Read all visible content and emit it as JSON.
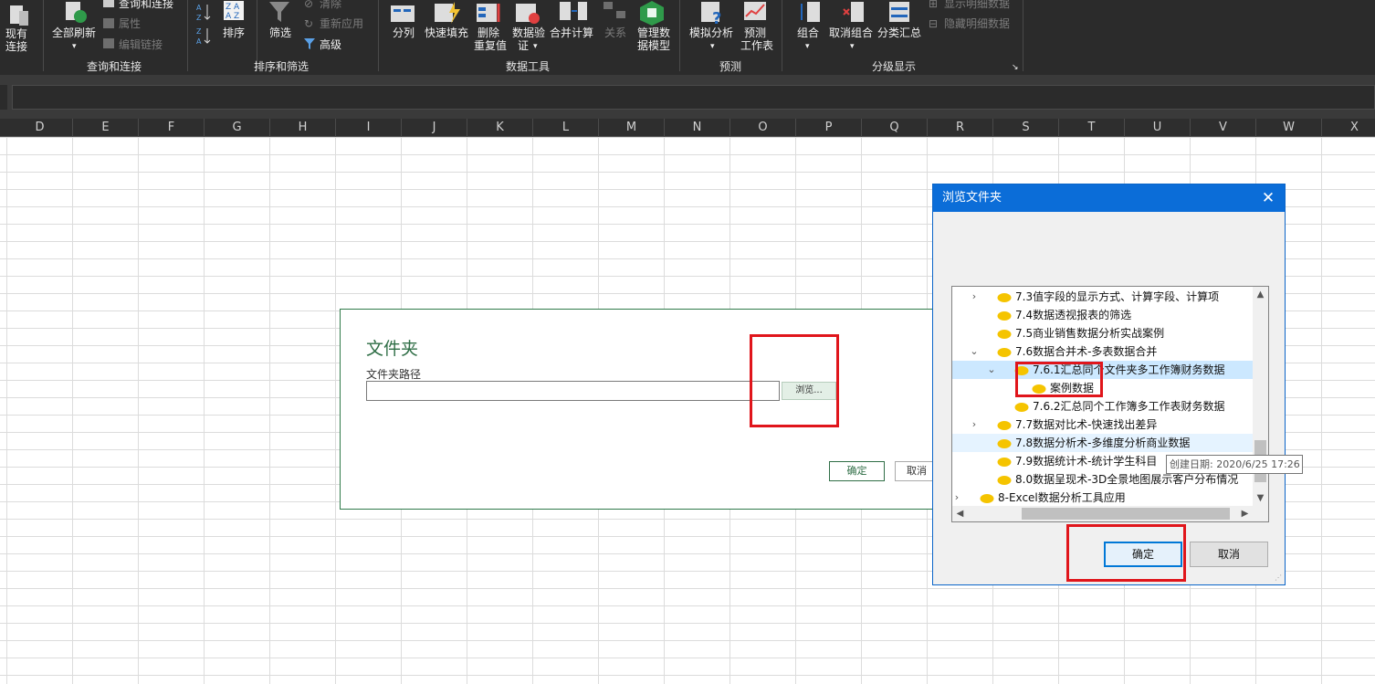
{
  "ribbon": {
    "existing_connections": [
      "现有",
      "连接"
    ],
    "refresh_all": "全部刷新",
    "queries_connections": "查询和连接",
    "properties": "属性",
    "edit_links": "编辑链接",
    "group_queries": "查询和连接",
    "sort": "排序",
    "filter": "筛选",
    "clear": "清除",
    "reapply": "重新应用",
    "advanced": "高级",
    "group_sort_filter": "排序和筛选",
    "text_to_columns": "分列",
    "flash_fill": "快速填充",
    "remove_duplicates": [
      "删除",
      "重复值"
    ],
    "data_validation": [
      "数据验",
      "证"
    ],
    "consolidate": "合并计算",
    "relationships": "关系",
    "manage_data_model": [
      "管理数",
      "据模型"
    ],
    "group_data_tools": "数据工具",
    "what_if": "模拟分析",
    "forecast_sheet": [
      "预测",
      "工作表"
    ],
    "group_forecast": "预测",
    "group_btn": "组合",
    "ungroup": "取消组合",
    "subtotal": "分类汇总",
    "show_detail": "显示明细数据",
    "hide_detail": "隐藏明细数据",
    "group_outline": "分级显示"
  },
  "columns": [
    "D",
    "E",
    "F",
    "G",
    "H",
    "I",
    "J",
    "K",
    "L",
    "M",
    "N",
    "O",
    "P",
    "Q",
    "R",
    "S",
    "T",
    "U",
    "V",
    "W",
    "X"
  ],
  "folder_dialog": {
    "title": "文件夹",
    "path_label": "文件夹路径",
    "path_value": "",
    "browse": "浏览...",
    "ok": "确定",
    "cancel": "取消"
  },
  "browse_dialog": {
    "title": "浏览文件夹",
    "close": "✕",
    "items": [
      {
        "label": "7.3值字段的显示方式、计算字段、计算项",
        "expander": "›",
        "depth": 2
      },
      {
        "label": "7.4数据透视报表的筛选",
        "expander": "",
        "depth": 2
      },
      {
        "label": "7.5商业销售数据分析实战案例",
        "expander": "",
        "depth": 2
      },
      {
        "label": "7.6数据合并术-多表数据合并",
        "expander": "⌄",
        "depth": 2
      },
      {
        "label": "7.6.1汇总同个文件夹多工作簿财务数据",
        "expander": "⌄",
        "depth": 3
      },
      {
        "label": "案例数据",
        "expander": "",
        "depth": 4
      },
      {
        "label": "7.6.2汇总同个工作簿多工作表财务数据",
        "expander": "",
        "depth": 3
      },
      {
        "label": "7.7数据对比术-快速找出差异",
        "expander": "›",
        "depth": 2
      },
      {
        "label": "7.8数据分析术-多维度分析商业数据",
        "expander": "",
        "depth": 2
      },
      {
        "label": "7.9数据统计术-统计学生科目",
        "expander": "",
        "depth": 2
      },
      {
        "label": "8.0数据呈现术-3D全景地图展示客户分布情况",
        "expander": "",
        "depth": 2
      },
      {
        "label": "8-Excel数据分析工具应用",
        "expander": "›",
        "depth": 1
      }
    ],
    "ok": "确定",
    "cancel": "取消",
    "tooltip": "创建日期: 2020/6/25 17:26"
  },
  "colors": {
    "accent_green": "#2f6e46",
    "title_blue": "#0b6dd8",
    "highlight_red": "#e0151b",
    "folder_yellow": "#f5c400"
  }
}
